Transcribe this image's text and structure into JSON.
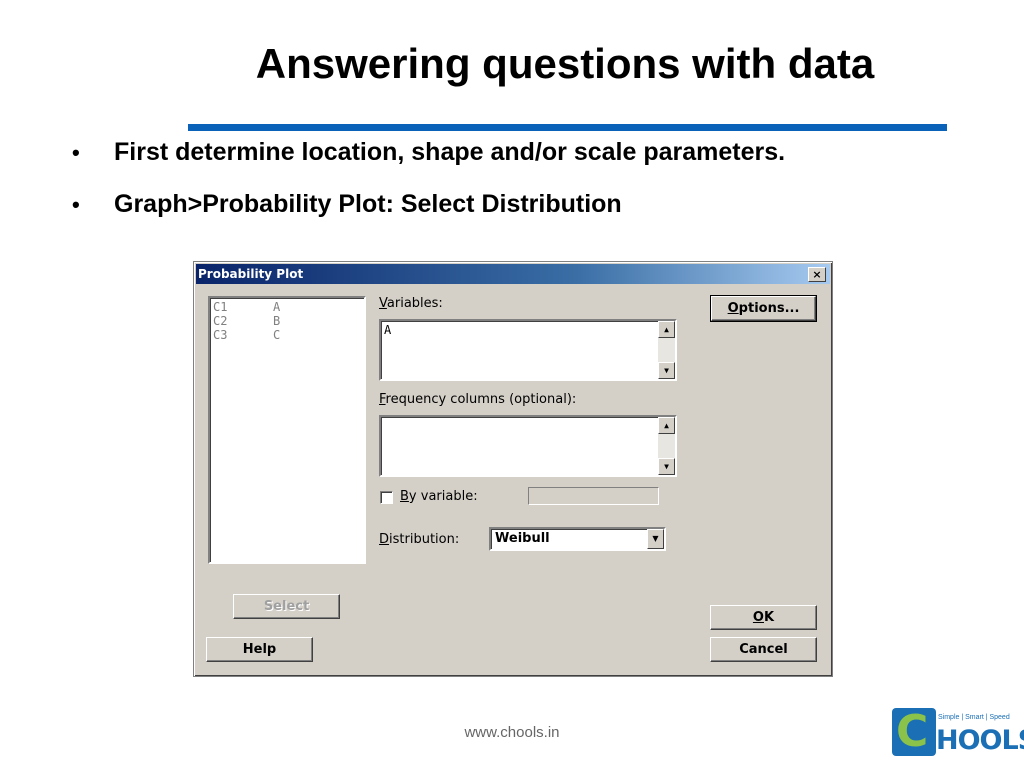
{
  "slide": {
    "title": "Answering questions with data",
    "bullets": [
      "First determine location, shape and/or scale parameters.",
      "Graph>Probability Plot:  Select Distribution"
    ],
    "bullet_symbol": "•"
  },
  "dialog": {
    "title": "Probability Plot",
    "close_symbol": "×",
    "columns": [
      {
        "id": "C1",
        "name": "A"
      },
      {
        "id": "C2",
        "name": "B"
      },
      {
        "id": "C3",
        "name": "C"
      }
    ],
    "variables_label_first": "V",
    "variables_label_rest": "ariables:",
    "variables_value": "A",
    "frequency_label_first": "F",
    "frequency_label_rest": "requency columns (optional):",
    "frequency_value": "",
    "by_variable_label_first": "B",
    "by_variable_label_rest": "y variable:",
    "by_variable_checked": false,
    "distribution_label_first": "D",
    "distribution_label_rest": "istribution:",
    "distribution_value": "Weibull",
    "buttons": {
      "options_first": "O",
      "options_rest": "ptions...",
      "select": "Select",
      "help": "Help",
      "ok_first": "O",
      "ok_rest": "K",
      "cancel": "Cancel"
    },
    "scroll_up": "▲",
    "scroll_down": "▼"
  },
  "footer": {
    "url": "www.chools.in"
  },
  "logo": {
    "letter": "C",
    "word": "HOOLS",
    "tagline": "Simple | Smart | Speed",
    "colors": {
      "primary": "#1a6fb5",
      "accent": "#8bc34a"
    }
  }
}
